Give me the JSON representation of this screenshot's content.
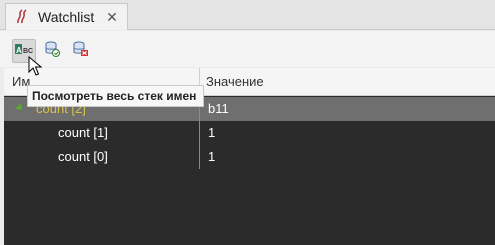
{
  "tab": {
    "label": "Watchlist",
    "close": "✕",
    "icon": "watchlist-icon"
  },
  "toolbar": {
    "buttons": [
      {
        "icon": "abc-names-icon",
        "text": "ABC"
      },
      {
        "icon": "database-refresh-icon"
      },
      {
        "icon": "database-delete-icon"
      }
    ]
  },
  "tooltip": {
    "text": "Посмотреть весь стек имен"
  },
  "table": {
    "columns": {
      "name": "Им",
      "value": "Значение"
    },
    "rows": [
      {
        "name": "count [2]",
        "value": "b11",
        "selected": true,
        "expanded": true
      },
      {
        "name": "count [1]",
        "value": "1"
      },
      {
        "name": "count [0]",
        "value": "1"
      }
    ]
  },
  "colors": {
    "accent_green": "#5aa832",
    "selection": "#6f6f6f",
    "table_bg": "#2b2b2b"
  }
}
